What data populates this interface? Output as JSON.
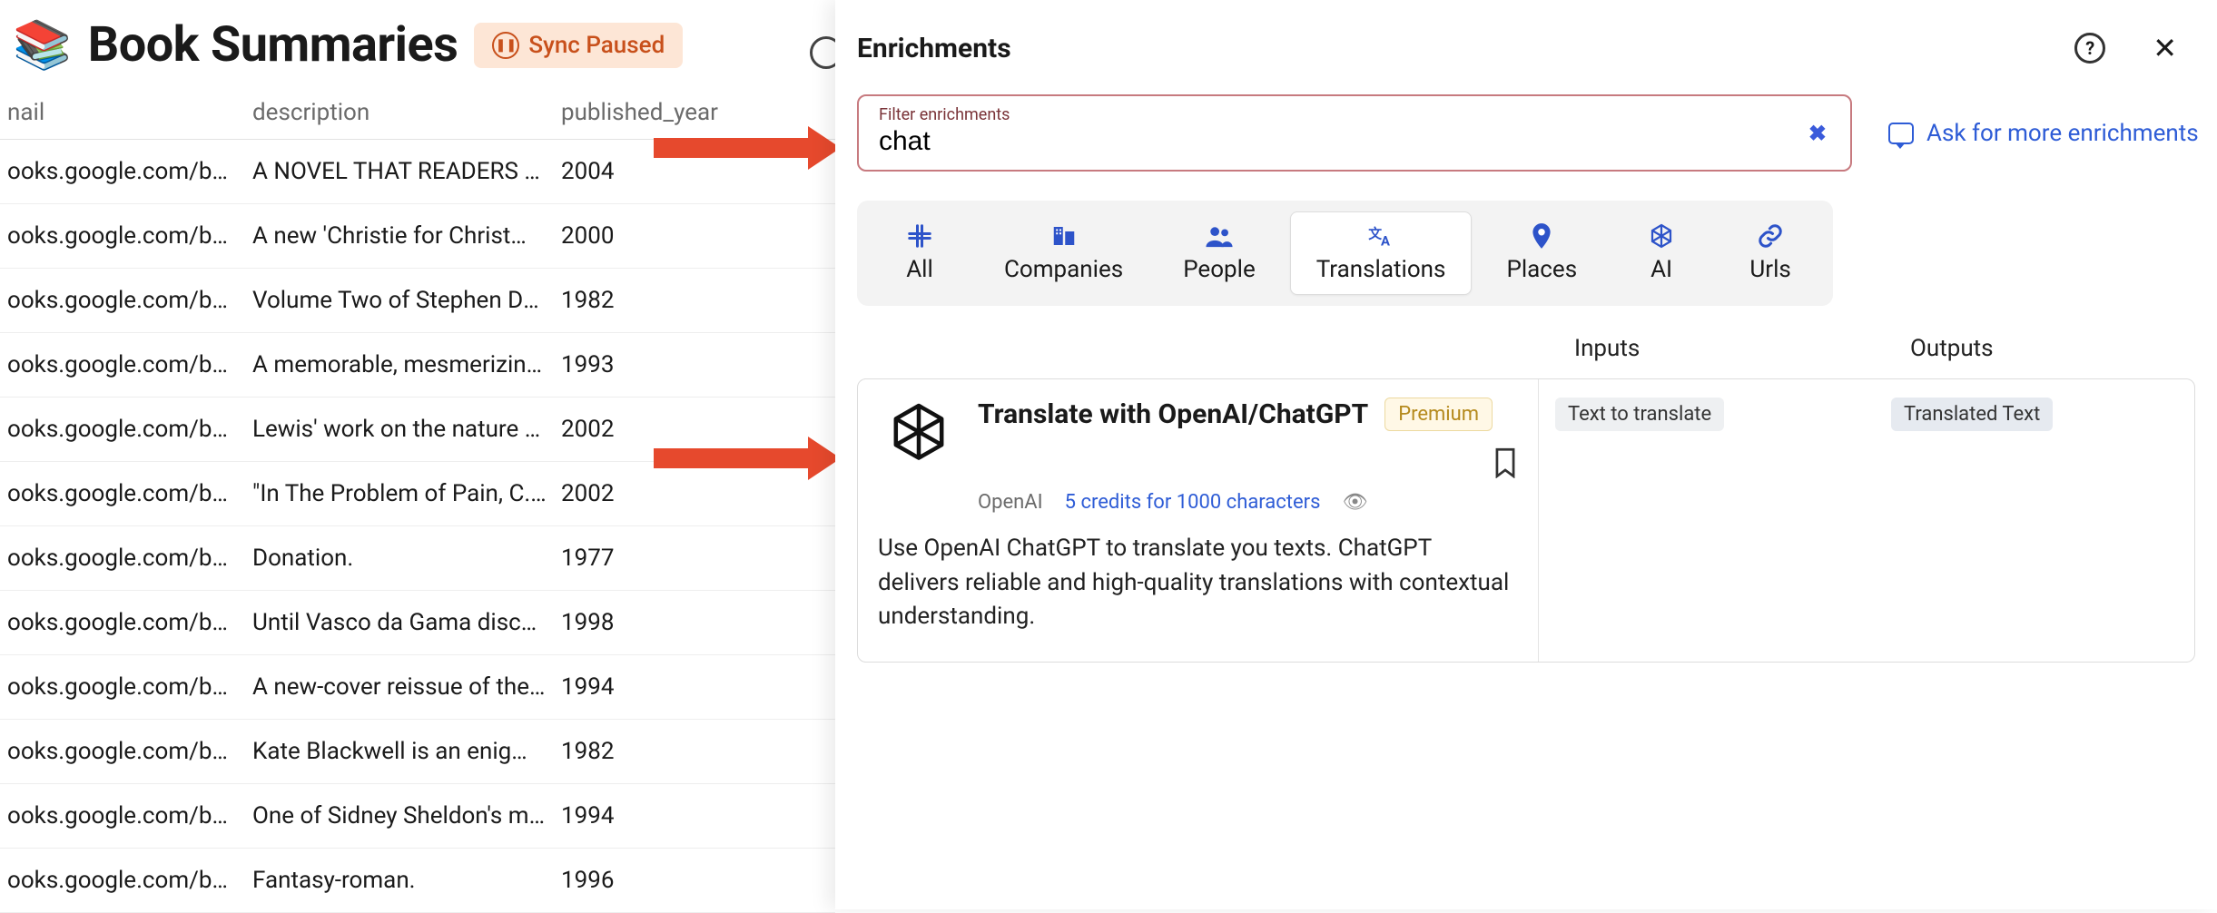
{
  "header": {
    "title": "Book Summaries",
    "sync_label": "Sync Paused"
  },
  "columns": {
    "url": "nail",
    "description": "description",
    "year": "published_year"
  },
  "rows": [
    {
      "url": "ooks.google.com/b…",
      "desc": "A NOVEL THAT READERS a…",
      "year": "2004"
    },
    {
      "url": "ooks.google.com/b…",
      "desc": "A new 'Christie for Christma…",
      "year": "2000"
    },
    {
      "url": "ooks.google.com/b…",
      "desc": "Volume Two of Stephen Do…",
      "year": "1982"
    },
    {
      "url": "ooks.google.com/b…",
      "desc": "A memorable, mesmerizing …",
      "year": "1993"
    },
    {
      "url": "ooks.google.com/b…",
      "desc": "Lewis' work on the nature of…",
      "year": "2002"
    },
    {
      "url": "ooks.google.com/b…",
      "desc": "\"In The Problem of Pain, C.S…",
      "year": "2002"
    },
    {
      "url": "ooks.google.com/b…",
      "desc": "Donation.",
      "year": "1977"
    },
    {
      "url": "ooks.google.com/b…",
      "desc": "Until Vasco da Gama discov…",
      "year": "1998"
    },
    {
      "url": "ooks.google.com/b…",
      "desc": "A new-cover reissue of the f…",
      "year": "1994"
    },
    {
      "url": "ooks.google.com/b…",
      "desc": "Kate Blackwell is an enigma…",
      "year": "1982"
    },
    {
      "url": "ooks.google.com/b…",
      "desc": "One of Sidney Sheldon's mo…",
      "year": "1994"
    },
    {
      "url": "ooks.google.com/b…",
      "desc": "Fantasy-roman.",
      "year": "1996"
    }
  ],
  "panel": {
    "title": "Enrichments",
    "filter_label": "Filter enrichments",
    "filter_value": "chat",
    "ask_more": "Ask for more enrichments",
    "categories": [
      {
        "key": "All",
        "icon": "#"
      },
      {
        "key": "Companies",
        "icon": "🏢"
      },
      {
        "key": "People",
        "icon": "👥"
      },
      {
        "key": "Translations",
        "icon": "✕ₐ"
      },
      {
        "key": "Places",
        "icon": "📍"
      },
      {
        "key": "AI",
        "icon": "✷"
      },
      {
        "key": "Urls",
        "icon": "🔗"
      }
    ],
    "active_category": "Translations",
    "io_labels": {
      "inputs": "Inputs",
      "outputs": "Outputs"
    },
    "result": {
      "title": "Translate with OpenAI/ChatGPT",
      "badge": "Premium",
      "vendor": "OpenAI",
      "credits": "5 credits for 1000 characters",
      "description": "Use OpenAI ChatGPT to translate you texts. ChatGPT delivers reliable and high-quality translations with contextual understanding.",
      "input_chip": "Text to translate",
      "output_chip": "Translated Text"
    }
  }
}
